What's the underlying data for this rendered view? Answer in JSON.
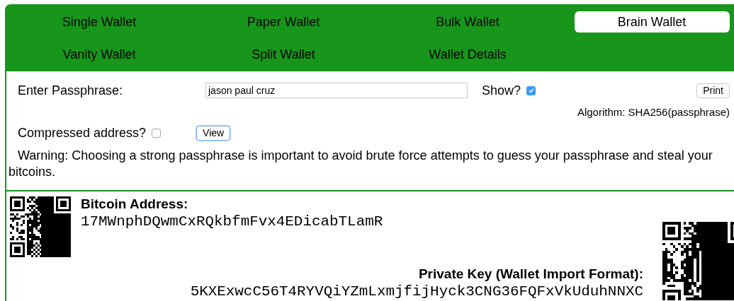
{
  "tabs": [
    {
      "label": "Single Wallet",
      "selected": false
    },
    {
      "label": "Paper Wallet",
      "selected": false
    },
    {
      "label": "Bulk Wallet",
      "selected": false
    },
    {
      "label": "Brain Wallet",
      "selected": true
    },
    {
      "label": "Vanity Wallet",
      "selected": false
    },
    {
      "label": "Split Wallet",
      "selected": false
    },
    {
      "label": "Wallet Details",
      "selected": false
    }
  ],
  "passphrase": {
    "label": "Enter Passphrase:",
    "value": "jason paul cruz",
    "show_label": "Show?",
    "show_checked": true
  },
  "print_button": "Print",
  "algorithm": "Algorithm: SHA256(passphrase)",
  "compressed": {
    "label": "Compressed address?",
    "checked": false
  },
  "view_button": "View",
  "warning": "Warning: Choosing a strong passphrase is important to avoid brute force attempts to guess your passphrase and steal your bitcoins.",
  "wallet": {
    "address_label": "Bitcoin Address:",
    "address": "17MWnphDQwmCxRQkbfmFvx4EDicabTLamR",
    "private_key_label": "Private Key (Wallet Import Format):",
    "private_key": "5KXExwcC56T4RYVQiYZmLxmjfijHyck3CNG36FQFxVkUduhNNXC"
  }
}
